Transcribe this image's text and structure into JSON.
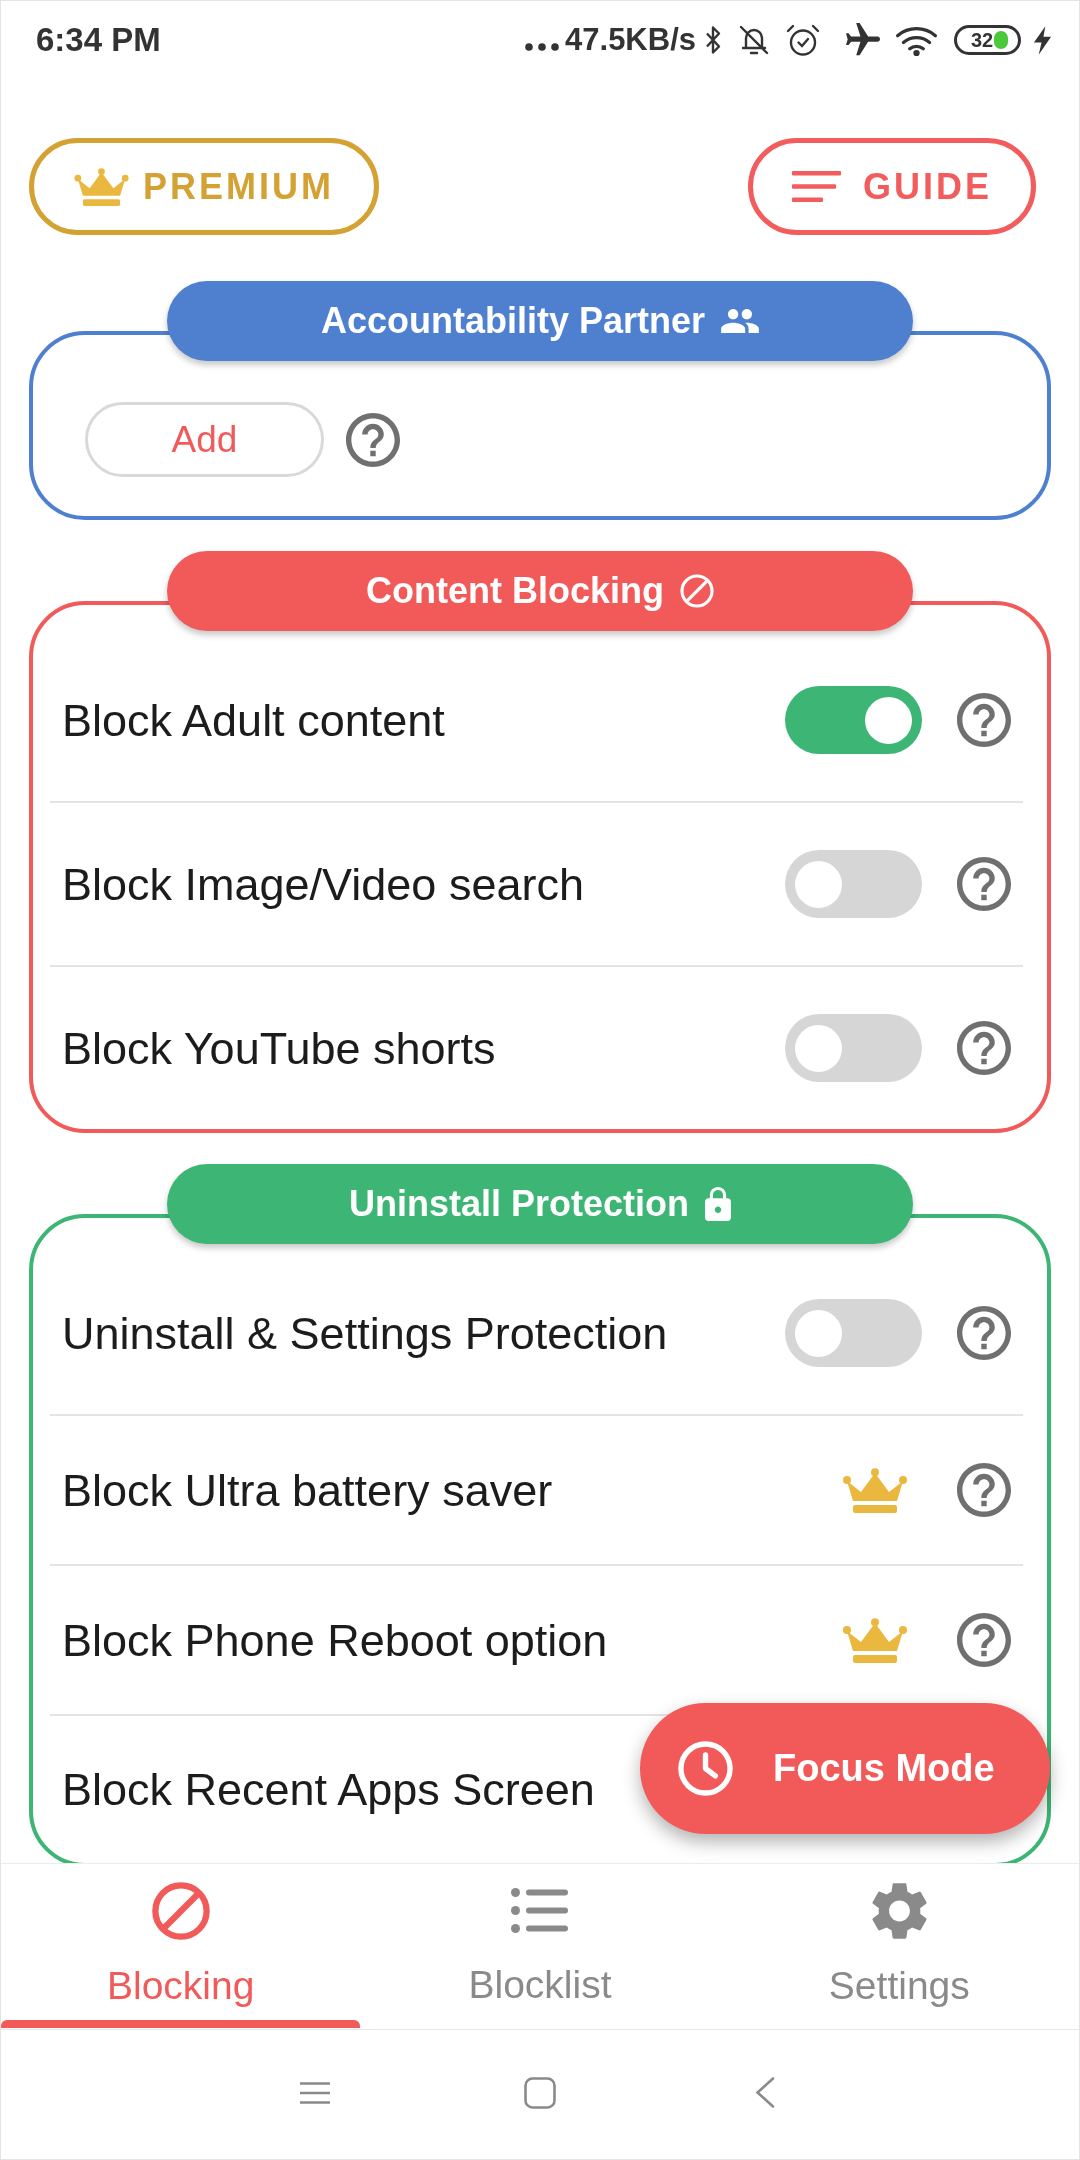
{
  "status_bar": {
    "time": "6:34 PM",
    "network_speed": "47.5KB/s",
    "battery": "32"
  },
  "header_buttons": [
    {
      "kind": "premium",
      "label": "PREMIUM"
    },
    {
      "kind": "guide",
      "label": "GUIDE"
    }
  ],
  "sections": [
    {
      "kind": "partner",
      "title": "Accountability Partner",
      "color": "#4f80d0",
      "add_button": "Add"
    },
    {
      "kind": "blocking",
      "title": "Content Blocking",
      "color": "#f25a5a",
      "rows": [
        {
          "kind": "toggle",
          "label": "Block Adult content",
          "on": true
        },
        {
          "kind": "toggle",
          "label": "Block Image/Video search",
          "on": false
        },
        {
          "kind": "toggle",
          "label": "Block YouTube shorts",
          "on": false
        }
      ]
    },
    {
      "kind": "protection",
      "title": "Uninstall Protection",
      "color": "#3db574",
      "rows": [
        {
          "kind": "toggle",
          "label": "Uninstall & Settings Protection",
          "on": false
        },
        {
          "kind": "premium",
          "label": "Block Ultra battery saver"
        },
        {
          "kind": "premium",
          "label": "Block Phone Reboot option"
        },
        {
          "kind": "text",
          "label": "Block Recent Apps Screen"
        }
      ]
    }
  ],
  "focus_button": {
    "label": "Focus Mode"
  },
  "bottom_nav": [
    {
      "label": "Blocking",
      "selected": true
    },
    {
      "label": "Blocklist",
      "selected": false
    },
    {
      "label": "Settings",
      "selected": false
    }
  ]
}
